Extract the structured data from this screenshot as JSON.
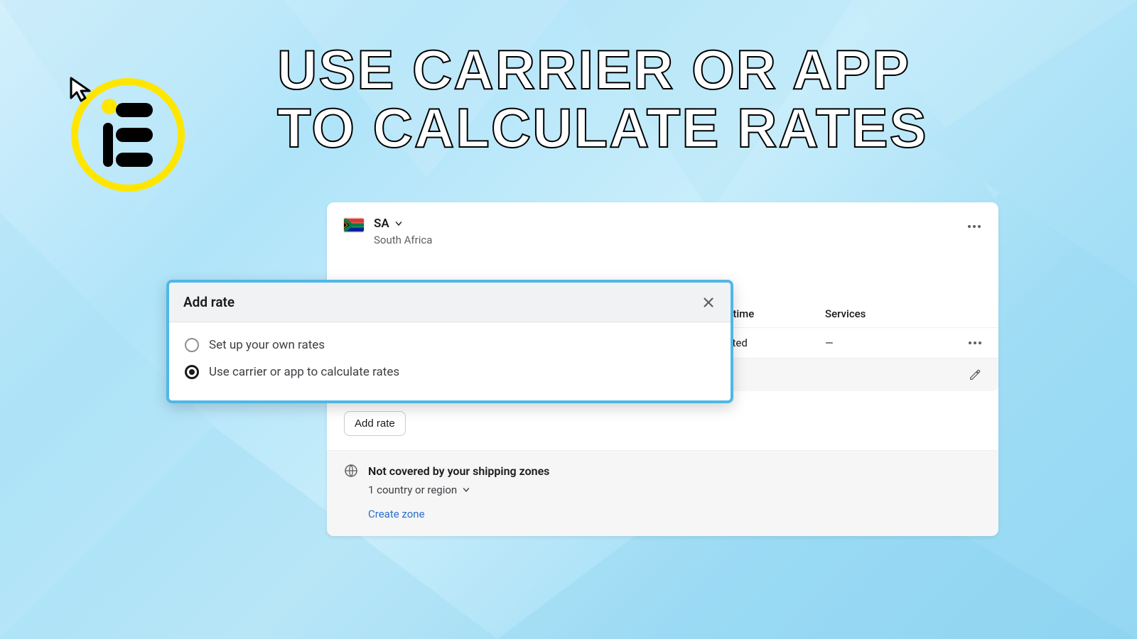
{
  "headline": {
    "line1": "USE CARRIER OR APP",
    "line2": "TO CALCULATE RATES"
  },
  "region": {
    "code": "SA",
    "name": "South Africa"
  },
  "columns": {
    "transit_time": "Transit time",
    "services": "Services"
  },
  "rate_row": {
    "transit_time_value": "Calculated",
    "services_value": "—"
  },
  "add_rate_button": "Add rate",
  "not_covered": {
    "title": "Not covered by your shipping zones",
    "subtitle": "1 country or region",
    "create_link": "Create zone"
  },
  "modal": {
    "title": "Add rate",
    "options": [
      {
        "label": "Set up your own rates",
        "selected": false
      },
      {
        "label": "Use carrier or app to calculate rates",
        "selected": true
      }
    ]
  }
}
